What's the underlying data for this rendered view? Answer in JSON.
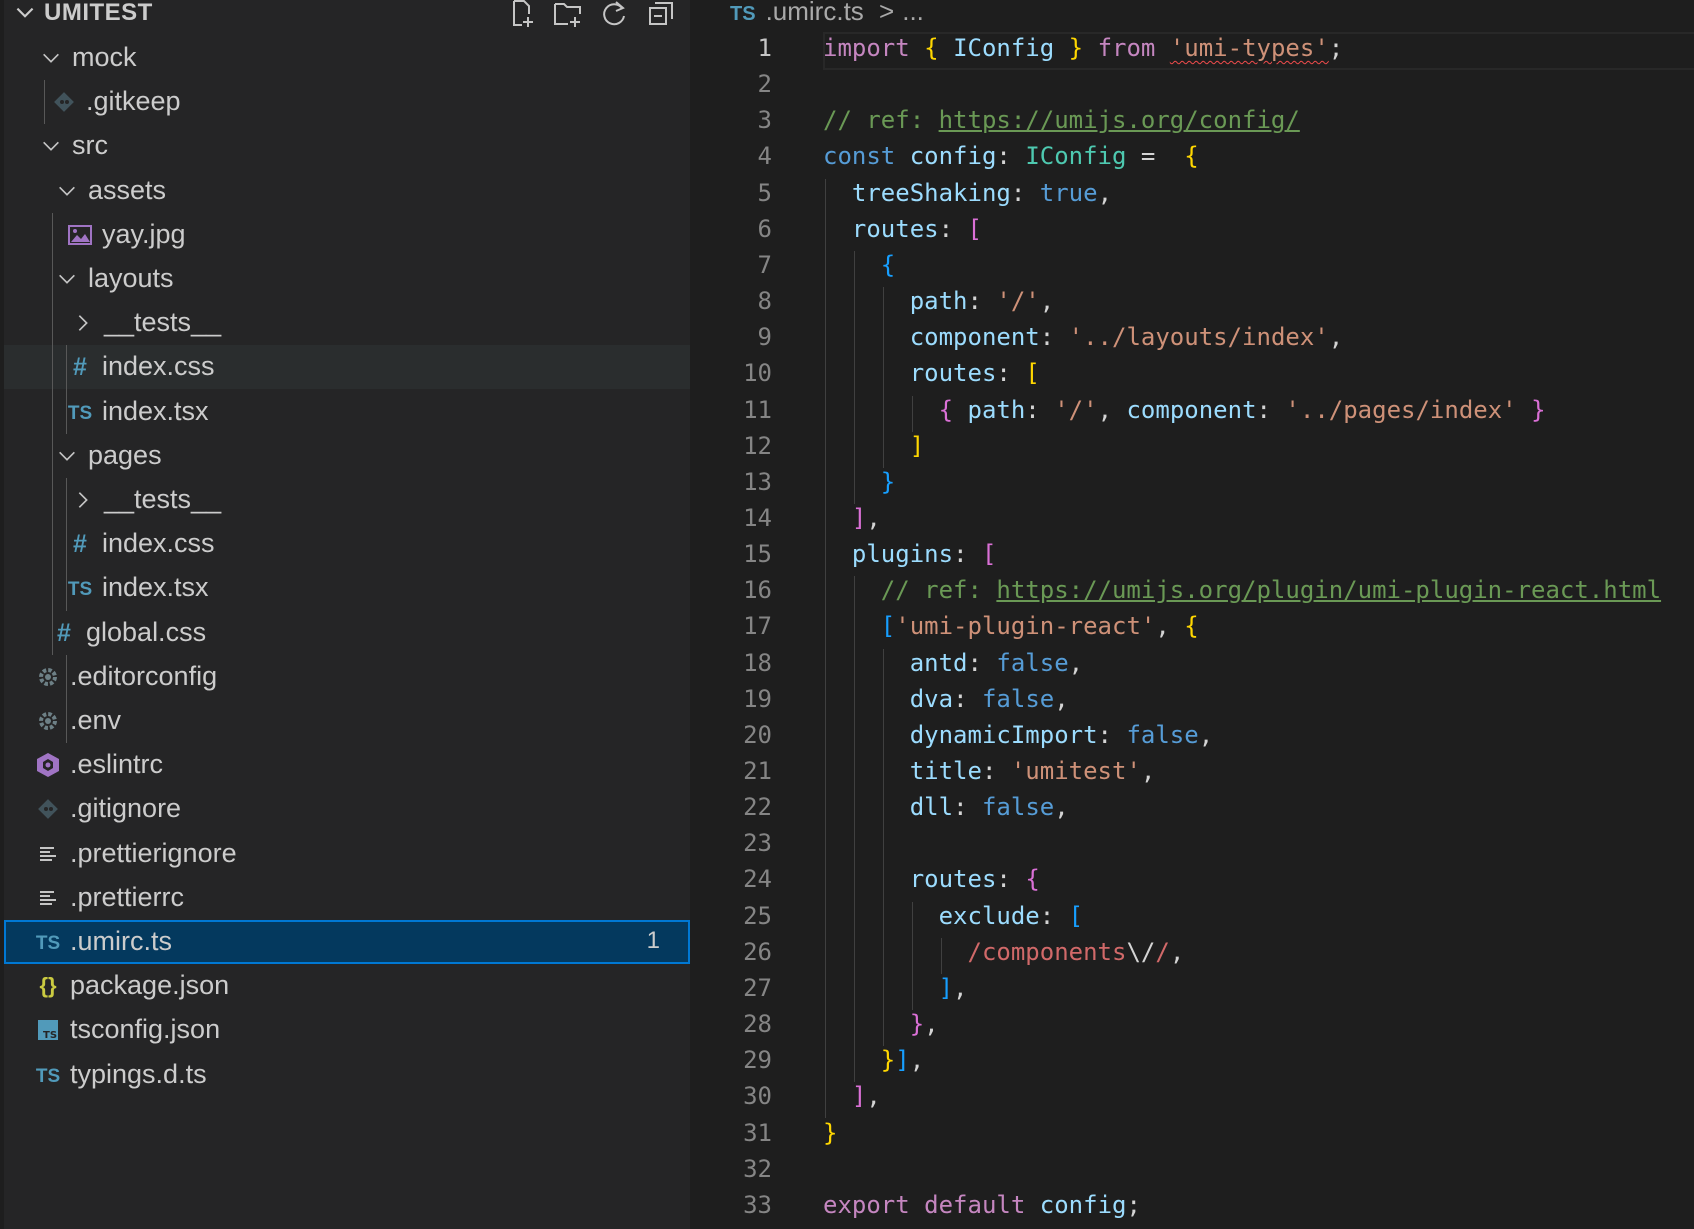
{
  "explorer": {
    "title": "UMITEST",
    "actions": [
      "new-file-icon",
      "new-folder-icon",
      "refresh-icon",
      "collapse-all-icon"
    ],
    "items": [
      {
        "label": "mock",
        "type": "folder",
        "depth": 1,
        "expanded": true,
        "icon": "chevron-down-icon"
      },
      {
        "label": ".gitkeep",
        "type": "file",
        "depth": 2,
        "icon": "git-icon"
      },
      {
        "label": "src",
        "type": "folder",
        "depth": 1,
        "expanded": true,
        "icon": "chevron-down-icon"
      },
      {
        "label": "assets",
        "type": "folder",
        "depth": 2,
        "expanded": true,
        "icon": "chevron-down-icon"
      },
      {
        "label": "yay.jpg",
        "type": "file",
        "depth": 3,
        "icon": "image-icon"
      },
      {
        "label": "layouts",
        "type": "folder",
        "depth": 2,
        "expanded": true,
        "icon": "chevron-down-icon"
      },
      {
        "label": "__tests__",
        "type": "folder",
        "depth": 3,
        "expanded": false,
        "icon": "chevron-right-icon"
      },
      {
        "label": "index.css",
        "type": "file",
        "depth": 3,
        "icon": "css-hash-icon",
        "state": "hover"
      },
      {
        "label": "index.tsx",
        "type": "file",
        "depth": 3,
        "icon": "ts-icon"
      },
      {
        "label": "pages",
        "type": "folder",
        "depth": 2,
        "expanded": true,
        "icon": "chevron-down-icon"
      },
      {
        "label": "__tests__",
        "type": "folder",
        "depth": 3,
        "expanded": false,
        "icon": "chevron-right-icon"
      },
      {
        "label": "index.css",
        "type": "file",
        "depth": 3,
        "icon": "css-hash-icon"
      },
      {
        "label": "index.tsx",
        "type": "file",
        "depth": 3,
        "icon": "ts-icon"
      },
      {
        "label": "global.css",
        "type": "file",
        "depth": 2,
        "icon": "css-hash-icon"
      },
      {
        "label": ".editorconfig",
        "type": "file",
        "depth": 1,
        "icon": "gear-icon"
      },
      {
        "label": ".env",
        "type": "file",
        "depth": 1,
        "icon": "gear-icon"
      },
      {
        "label": ".eslintrc",
        "type": "file",
        "depth": 1,
        "icon": "eslint-icon"
      },
      {
        "label": ".gitignore",
        "type": "file",
        "depth": 1,
        "icon": "git-icon"
      },
      {
        "label": ".prettierignore",
        "type": "file",
        "depth": 1,
        "icon": "lines-icon"
      },
      {
        "label": ".prettierrc",
        "type": "file",
        "depth": 1,
        "icon": "lines-icon"
      },
      {
        "label": ".umirc.ts",
        "type": "file",
        "depth": 1,
        "icon": "ts-icon",
        "state": "selected",
        "badge": "1"
      },
      {
        "label": "package.json",
        "type": "file",
        "depth": 1,
        "icon": "json-braces-icon"
      },
      {
        "label": "tsconfig.json",
        "type": "file",
        "depth": 1,
        "icon": "tsconfig-icon"
      },
      {
        "label": "typings.d.ts",
        "type": "file",
        "depth": 1,
        "icon": "ts-icon"
      }
    ]
  },
  "editor": {
    "breadcrumb": {
      "icon": "TS",
      "file": ".umirc.ts",
      "sep": ">",
      "more": "..."
    },
    "active_line": 1,
    "lines": [
      [
        [
          "import",
          "k"
        ],
        [
          " ",
          "p"
        ],
        [
          "{",
          "b1"
        ],
        [
          " ",
          "p"
        ],
        [
          "IConfig",
          "v"
        ],
        [
          " ",
          "p"
        ],
        [
          "}",
          "b1"
        ],
        [
          " ",
          "p"
        ],
        [
          "from",
          "k"
        ],
        [
          " ",
          "p"
        ],
        [
          "'umi-types'",
          "s squig"
        ],
        [
          ";",
          "p"
        ]
      ],
      [],
      [
        [
          "// ref: ",
          "c"
        ],
        [
          "https://umijs.org/config/",
          "u"
        ]
      ],
      [
        [
          "const",
          "kb"
        ],
        [
          " ",
          "p"
        ],
        [
          "config",
          "v"
        ],
        [
          ": ",
          "p"
        ],
        [
          "IConfig",
          "t"
        ],
        [
          " =  ",
          "p"
        ],
        [
          "{",
          "b1"
        ]
      ],
      [
        [
          "  ",
          "p"
        ],
        [
          "treeShaking",
          "v"
        ],
        [
          ": ",
          "p"
        ],
        [
          "true",
          "kb"
        ],
        [
          ",",
          "p"
        ]
      ],
      [
        [
          "  ",
          "p"
        ],
        [
          "routes",
          "v"
        ],
        [
          ": ",
          "p"
        ],
        [
          "[",
          "b2"
        ]
      ],
      [
        [
          "    ",
          "p"
        ],
        [
          "{",
          "b3"
        ]
      ],
      [
        [
          "      ",
          "p"
        ],
        [
          "path",
          "v"
        ],
        [
          ": ",
          "p"
        ],
        [
          "'/'",
          "s"
        ],
        [
          ",",
          "p"
        ]
      ],
      [
        [
          "      ",
          "p"
        ],
        [
          "component",
          "v"
        ],
        [
          ": ",
          "p"
        ],
        [
          "'../layouts/index'",
          "s"
        ],
        [
          ",",
          "p"
        ]
      ],
      [
        [
          "      ",
          "p"
        ],
        [
          "routes",
          "v"
        ],
        [
          ": ",
          "p"
        ],
        [
          "[",
          "b1"
        ]
      ],
      [
        [
          "        ",
          "p"
        ],
        [
          "{",
          "b2"
        ],
        [
          " ",
          "p"
        ],
        [
          "path",
          "v"
        ],
        [
          ": ",
          "p"
        ],
        [
          "'/'",
          "s"
        ],
        [
          ", ",
          "p"
        ],
        [
          "component",
          "v"
        ],
        [
          ": ",
          "p"
        ],
        [
          "'../pages/index'",
          "s"
        ],
        [
          " ",
          "p"
        ],
        [
          "}",
          "b2"
        ]
      ],
      [
        [
          "      ",
          "p"
        ],
        [
          "]",
          "b1"
        ]
      ],
      [
        [
          "    ",
          "p"
        ],
        [
          "}",
          "b3"
        ]
      ],
      [
        [
          "  ",
          "p"
        ],
        [
          "]",
          "b2"
        ],
        [
          ",",
          "p"
        ]
      ],
      [
        [
          "  ",
          "p"
        ],
        [
          "plugins",
          "v"
        ],
        [
          ": ",
          "p"
        ],
        [
          "[",
          "b2"
        ]
      ],
      [
        [
          "    ",
          "p"
        ],
        [
          "// ref: ",
          "c"
        ],
        [
          "https://umijs.org/plugin/umi-plugin-react.html",
          "u"
        ]
      ],
      [
        [
          "    ",
          "p"
        ],
        [
          "[",
          "b3"
        ],
        [
          "'umi-plugin-react'",
          "s"
        ],
        [
          ", ",
          "p"
        ],
        [
          "{",
          "b1"
        ]
      ],
      [
        [
          "      ",
          "p"
        ],
        [
          "antd",
          "v"
        ],
        [
          ": ",
          "p"
        ],
        [
          "false",
          "kb"
        ],
        [
          ",",
          "p"
        ]
      ],
      [
        [
          "      ",
          "p"
        ],
        [
          "dva",
          "v"
        ],
        [
          ": ",
          "p"
        ],
        [
          "false",
          "kb"
        ],
        [
          ",",
          "p"
        ]
      ],
      [
        [
          "      ",
          "p"
        ],
        [
          "dynamicImport",
          "v"
        ],
        [
          ": ",
          "p"
        ],
        [
          "false",
          "kb"
        ],
        [
          ",",
          "p"
        ]
      ],
      [
        [
          "      ",
          "p"
        ],
        [
          "title",
          "v"
        ],
        [
          ": ",
          "p"
        ],
        [
          "'umitest'",
          "s"
        ],
        [
          ",",
          "p"
        ]
      ],
      [
        [
          "      ",
          "p"
        ],
        [
          "dll",
          "v"
        ],
        [
          ": ",
          "p"
        ],
        [
          "false",
          "kb"
        ],
        [
          ",",
          "p"
        ]
      ],
      [],
      [
        [
          "      ",
          "p"
        ],
        [
          "routes",
          "v"
        ],
        [
          ": ",
          "p"
        ],
        [
          "{",
          "b2"
        ]
      ],
      [
        [
          "        ",
          "p"
        ],
        [
          "exclude",
          "v"
        ],
        [
          ": ",
          "p"
        ],
        [
          "[",
          "b3"
        ]
      ],
      [
        [
          "          ",
          "p"
        ],
        [
          "/components",
          "re"
        ],
        [
          "\\/",
          "p"
        ],
        [
          "/",
          "re"
        ],
        [
          ",",
          "p"
        ]
      ],
      [
        [
          "        ",
          "p"
        ],
        [
          "]",
          "b3"
        ],
        [
          ",",
          "p"
        ]
      ],
      [
        [
          "      ",
          "p"
        ],
        [
          "}",
          "b2"
        ],
        [
          ",",
          "p"
        ]
      ],
      [
        [
          "    ",
          "p"
        ],
        [
          "}",
          "b1"
        ],
        [
          "]",
          "b3"
        ],
        [
          ",",
          "p"
        ]
      ],
      [
        [
          "  ",
          "p"
        ],
        [
          "]",
          "b2"
        ],
        [
          ",",
          "p"
        ]
      ],
      [
        [
          "}",
          "b1"
        ]
      ],
      [],
      [
        [
          "export",
          "k"
        ],
        [
          " ",
          "p"
        ],
        [
          "default",
          "k"
        ],
        [
          " ",
          "p"
        ],
        [
          "config",
          "v"
        ],
        [
          ";",
          "p"
        ]
      ]
    ]
  },
  "colors": {
    "selection": "#04395e",
    "focus_border": "#0078d4",
    "ts_icon": "#519aba",
    "css_icon": "#519aba",
    "json_icon": "#cbcb41"
  }
}
